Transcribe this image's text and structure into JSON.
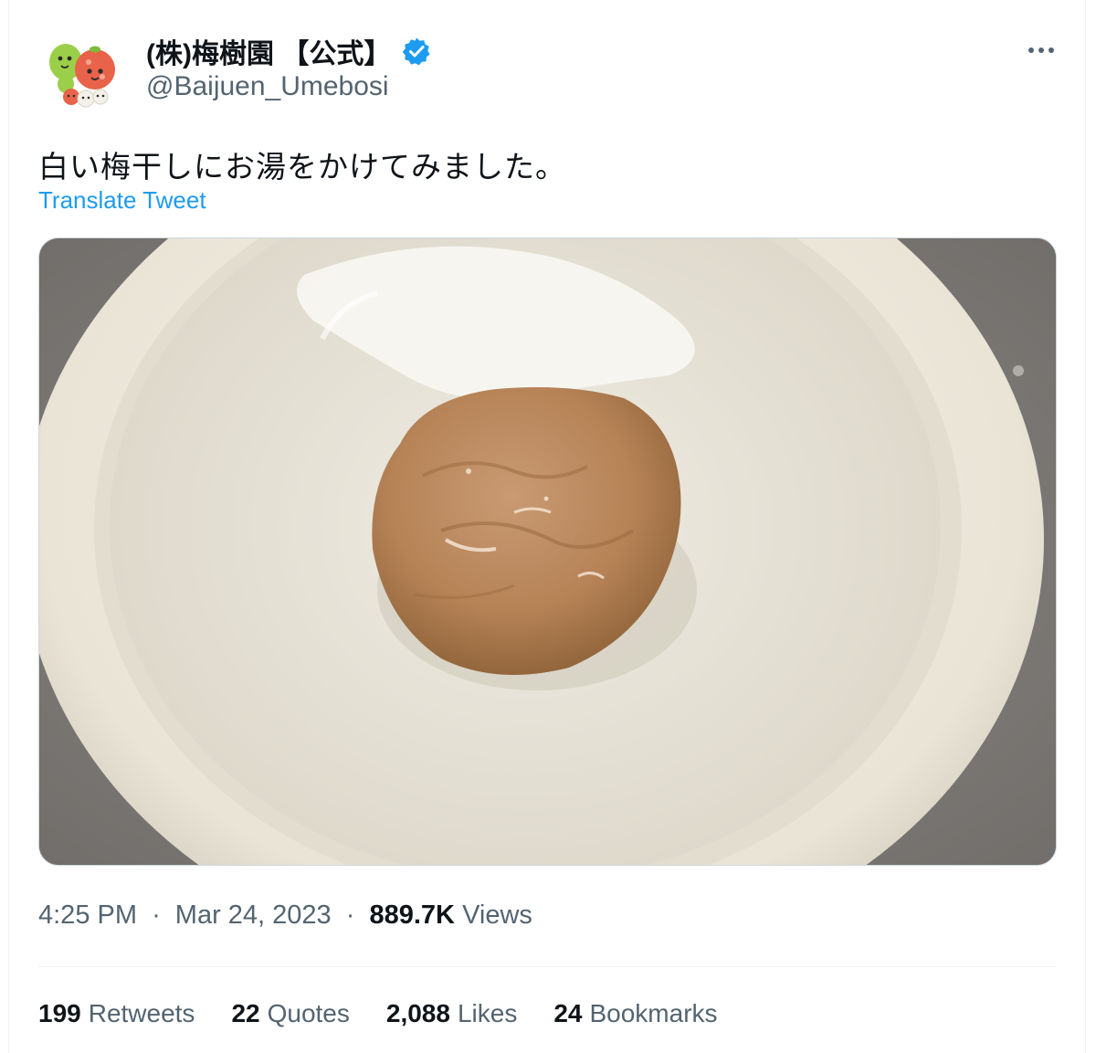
{
  "tweet": {
    "display_name": "(株)梅樹園 【公式】",
    "handle": "@Baijuen_Umebosi",
    "verified": true,
    "text": "白い梅干しにお湯をかけてみました。",
    "translate_label": "Translate Tweet",
    "time": "4:25 PM",
    "date": "Mar 24, 2023",
    "separator": "·",
    "views_count": "889.7K",
    "views_label": "Views"
  },
  "stats": [
    {
      "count": "199",
      "label": "Retweets"
    },
    {
      "count": "22",
      "label": "Quotes"
    },
    {
      "count": "2,088",
      "label": "Likes"
    },
    {
      "count": "24",
      "label": "Bookmarks"
    }
  ],
  "icons": {
    "avatar": "mascot-characters-avatar",
    "verified": "verified-badge-icon",
    "more": "more-options-icon"
  },
  "colors": {
    "accent": "#1d9bf0",
    "text_primary": "#0f1419",
    "text_secondary": "#536471"
  }
}
